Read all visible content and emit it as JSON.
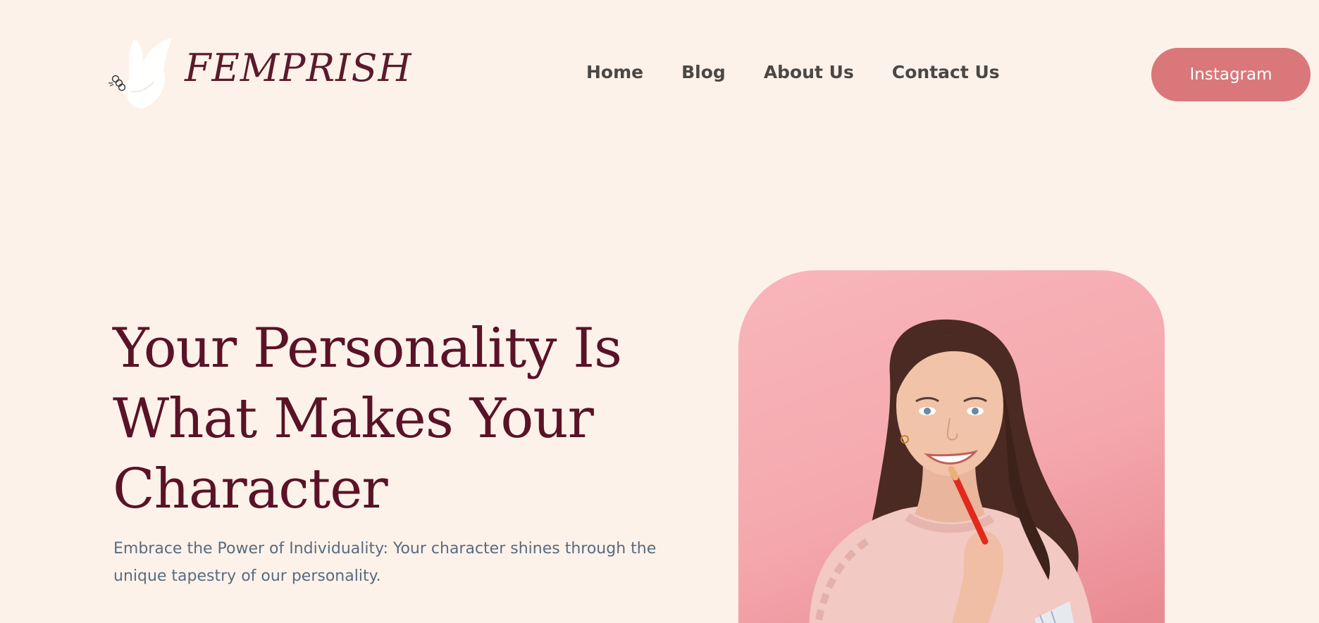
{
  "header": {
    "logo": {
      "icon": "dove-icon",
      "text": "FEMPRISH"
    },
    "nav": [
      {
        "label": "Home"
      },
      {
        "label": "Blog"
      },
      {
        "label": "About Us"
      },
      {
        "label": "Contact Us"
      }
    ],
    "cta_label": "Instagram"
  },
  "hero": {
    "title": "Your Personality Is What Makes Your Character",
    "subtitle": "Embrace the Power of Individuality: Your character shines through the unique tapestry of our personality.",
    "image": "woman-with-pencil-photo"
  },
  "colors": {
    "background": "#fdf2ea",
    "brand": "#5a1227",
    "accent": "#d9777a",
    "nav_text": "#4a4744",
    "body_text": "#5a6a80",
    "photo_bg": "#f8b6bb"
  }
}
